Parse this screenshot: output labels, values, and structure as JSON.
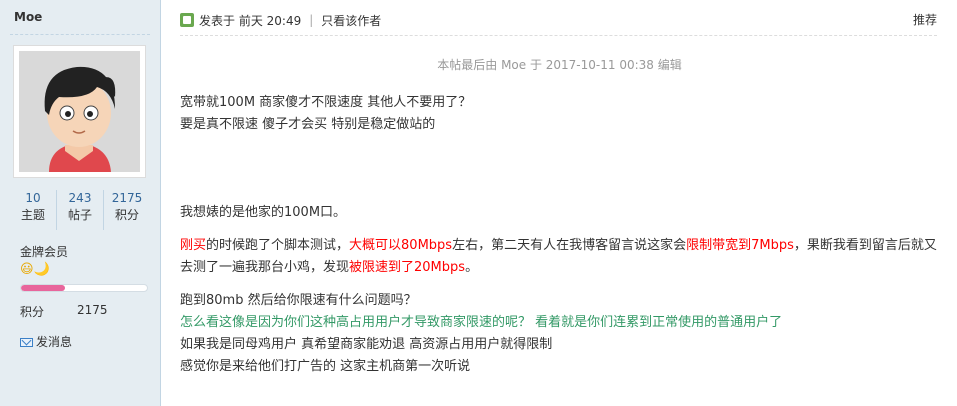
{
  "sidebar": {
    "username": "Moe",
    "stats": [
      {
        "value": "10",
        "label": "主题"
      },
      {
        "value": "243",
        "label": "帖子"
      },
      {
        "value": "2175",
        "label": "积分"
      }
    ],
    "group": "金牌会员",
    "emoji": "😃🌙",
    "progress_fraction": 0.35,
    "points_label": "积分",
    "points_value": "2175",
    "message_label": "发消息"
  },
  "post": {
    "posted_label": "发表于",
    "posted_time": "前天 20:49",
    "author_only": "只看该作者",
    "recommend": "推荐",
    "edit_note": "本帖最后由 Moe 于 2017-10-11 00:38 编辑",
    "lines": {
      "l1": "宽带就100M  商家傻才不限速度    其他人不要用了？",
      "l2": "要是真不限速 傻子才会买  特别是稳定做站的",
      "l3": "我想婊的是他家的100M口。",
      "l4a": "刚买",
      "l4b": "的时候跑了个脚本测试，",
      "l4c": "大概可以80Mbps",
      "l4d": "左右，第二天有人在我博客留言说这家会",
      "l4e": "限制带宽到7Mbps",
      "l4f": "，果断我看到留言后就又去测了一遍我那台小鸡，发现",
      "l4g": "被限速到了20Mbps",
      "l4h": "。",
      "l5": "跑到80mb 然后给你限速有什么问题吗？",
      "l6": "怎么看这像是因为你们这种高占用用户才导致商家限速的呢？ 看着就是你们连累到正常使用的普通用户了",
      "l7": "如果我是同母鸡用户 真希望商家能劝退 高资源占用用户就得限制",
      "l8": "感觉你是来给他们打广告的 这家主机商第一次听说"
    }
  }
}
